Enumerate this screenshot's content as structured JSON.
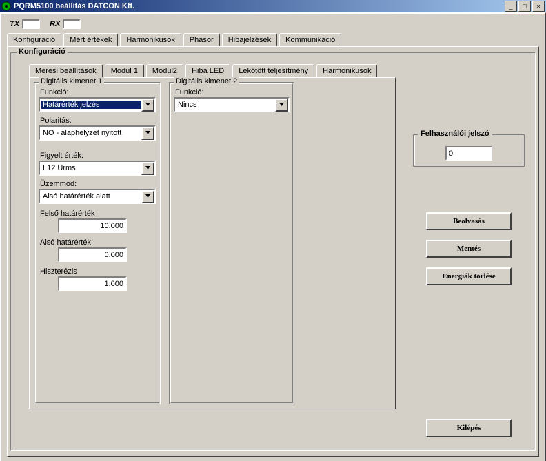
{
  "window": {
    "title": "PQRM5100 beállítás          DATCON Kft."
  },
  "txrx": {
    "tx": "TX",
    "rx": "RX"
  },
  "tabs": {
    "main": [
      "Konfiguráció",
      "Mért értékek",
      "Harmonikusok",
      "Phasor",
      "Hibajelzések",
      "Kommunikáció"
    ],
    "inner": [
      "Mérési beállítások",
      "Modul 1",
      "Modul2",
      "Hiba LED",
      "Lekötött teljesítmény",
      "Harmonikusok"
    ]
  },
  "group_title": "Konfiguráció",
  "dig1": {
    "title": "Digitális kimenet 1",
    "funkcio_lbl": "Funkció:",
    "funkcio_val": "Határérték jelzés",
    "polaritas_lbl": "Polaritás:",
    "polaritas_val": "NO - alaphelyzet nyitott",
    "figyelt_lbl": "Figyelt érték:",
    "figyelt_val": "L12 Urms",
    "uzemmod_lbl": "Üzemmód:",
    "uzemmod_val": "Alsó határérték alatt",
    "felso_lbl": "Felső határérték",
    "felso_val": "10.000",
    "also_lbl": "Alsó határérték",
    "also_val": "0.000",
    "hiszt_lbl": "Hiszterézis",
    "hiszt_val": "1.000"
  },
  "dig2": {
    "title": "Digitális kimenet 2",
    "funkcio_lbl": "Funkció:",
    "funkcio_val": "Nincs"
  },
  "pw": {
    "title": "Felhasználói jelszó",
    "value": "0"
  },
  "buttons": {
    "read": "Beolvasás",
    "save": "Mentés",
    "erase": "Energiák törlése",
    "exit": "Kilépés"
  }
}
